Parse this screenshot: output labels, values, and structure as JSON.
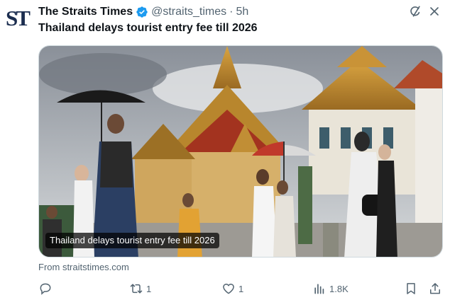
{
  "post": {
    "avatar_text": "ST",
    "display_name": "The Straits Times",
    "handle": "@straits_times",
    "separator": "·",
    "time": "5h",
    "text": "Thailand delays tourist entry fee till 2026",
    "verified_color": "#1d9bf0"
  },
  "media": {
    "caption": "Thailand delays tourist entry fee till 2026",
    "source": "From straitstimes.com"
  },
  "actions": {
    "reply_count": "",
    "repost_count": "1",
    "like_count": "1",
    "views_count": "1.8K"
  },
  "icons": [
    "grok-icon",
    "more-icon",
    "reply-icon",
    "repost-icon",
    "like-icon",
    "views-icon",
    "bookmark-icon",
    "share-icon"
  ]
}
